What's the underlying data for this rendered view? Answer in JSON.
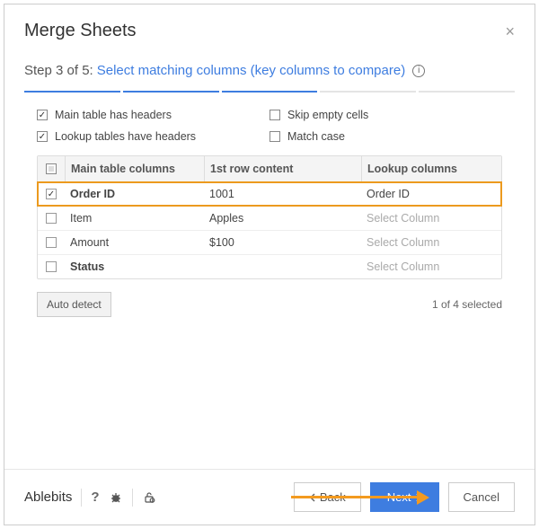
{
  "header": {
    "title": "Merge Sheets"
  },
  "step": {
    "prefix": "Step 3 of 5:",
    "link": "Select matching columns (key columns to compare)"
  },
  "options": {
    "main_headers": {
      "label": "Main table has headers",
      "checked": true
    },
    "skip_empty": {
      "label": "Skip empty cells",
      "checked": false
    },
    "lookup_headers": {
      "label": "Lookup tables have headers",
      "checked": true
    },
    "match_case": {
      "label": "Match case",
      "checked": false
    }
  },
  "table": {
    "headers": {
      "main": "Main table columns",
      "first_row": "1st row content",
      "lookup": "Lookup columns"
    },
    "placeholder": "Select Column",
    "rows": [
      {
        "checked": true,
        "main": "Order ID",
        "first_row": "1001",
        "lookup": "Order ID",
        "highlight": true
      },
      {
        "checked": false,
        "main": "Item",
        "first_row": "Apples",
        "lookup": "",
        "highlight": false
      },
      {
        "checked": false,
        "main": "Amount",
        "first_row": "$100",
        "lookup": "",
        "highlight": false
      },
      {
        "checked": false,
        "main": "Status",
        "first_row": "",
        "lookup": "",
        "highlight": false,
        "bold": true
      }
    ]
  },
  "auto_detect": "Auto detect",
  "selection_count": "1 of 4 selected",
  "footer": {
    "brand": "Ablebits",
    "back": "Back",
    "next": "Next",
    "cancel": "Cancel"
  }
}
